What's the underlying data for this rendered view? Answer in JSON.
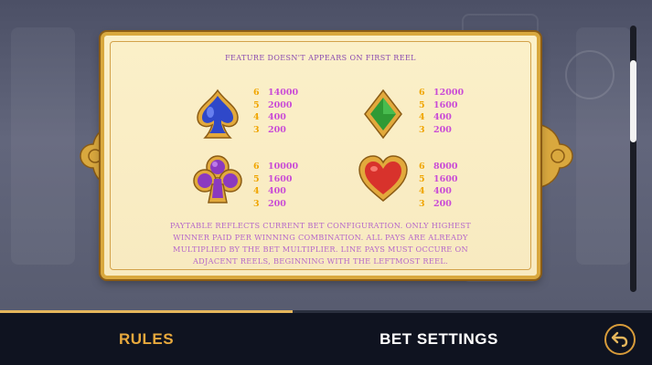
{
  "panel": {
    "feature_note": "FEATURE DOESN'T APPEARS ON FIRST REEL",
    "symbols": [
      {
        "icon": "spade-icon",
        "color": "#2f48c9",
        "pays": [
          {
            "count": "6",
            "value": "14000"
          },
          {
            "count": "5",
            "value": "2000"
          },
          {
            "count": "4",
            "value": "400"
          },
          {
            "count": "3",
            "value": "200"
          }
        ]
      },
      {
        "icon": "diamond-icon",
        "color": "#2f9a35",
        "pays": [
          {
            "count": "6",
            "value": "12000"
          },
          {
            "count": "5",
            "value": "1600"
          },
          {
            "count": "4",
            "value": "400"
          },
          {
            "count": "3",
            "value": "200"
          }
        ]
      },
      {
        "icon": "club-icon",
        "color": "#8b3ac0",
        "pays": [
          {
            "count": "6",
            "value": "10000"
          },
          {
            "count": "5",
            "value": "1600"
          },
          {
            "count": "4",
            "value": "400"
          },
          {
            "count": "3",
            "value": "200"
          }
        ]
      },
      {
        "icon": "heart-icon",
        "color": "#d8322c",
        "pays": [
          {
            "count": "6",
            "value": "8000"
          },
          {
            "count": "5",
            "value": "1600"
          },
          {
            "count": "4",
            "value": "400"
          },
          {
            "count": "3",
            "value": "200"
          }
        ]
      }
    ],
    "disclaimer": "PAYTABLE REFLECTS CURRENT BET CONFIGURATION. ONLY HIGHEST WINNER PAID PER WINNING COMBINATION. ALL PAYS ARE ALREADY MULTIPLIED BY THE BET MULTIPLIER. LINE PAYS MUST OCCURE ON ADJACENT REELS, BEGINNING WITH THE LEFTMOST REEL."
  },
  "bottom_nav": {
    "tabs": [
      {
        "label": "RULES",
        "active": true
      },
      {
        "label": "BET SETTINGS",
        "active": false
      }
    ],
    "back_icon": "back-arrow-icon"
  },
  "colors": {
    "accent_gold": "#e8a93d",
    "pay_count": "#f0a500",
    "pay_value": "#c94bd6",
    "text_purple": "#b567c9"
  }
}
